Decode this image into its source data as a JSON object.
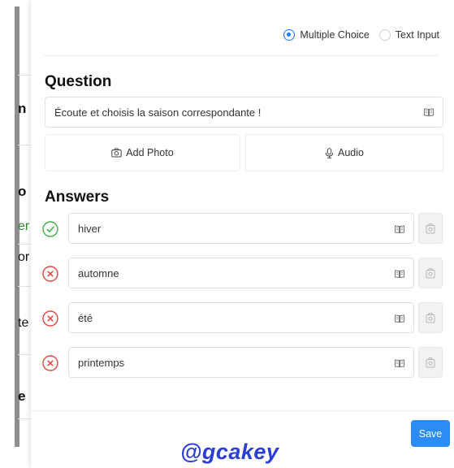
{
  "background_fragments": [
    "n",
    "o",
    "er",
    "or",
    "te",
    "e"
  ],
  "question_type": {
    "options": [
      {
        "label": "Multiple Choice",
        "selected": true
      },
      {
        "label": "Text Input",
        "selected": false
      }
    ]
  },
  "question": {
    "heading": "Question",
    "value": "Écoute et choisis la saison correspondante !",
    "translate_icon": "book-icon"
  },
  "media": {
    "add_photo_label": "Add Photo",
    "audio_label": "Audio"
  },
  "answers": {
    "heading": "Answers",
    "items": [
      {
        "text": "hiver",
        "correct": true
      },
      {
        "text": "automne",
        "correct": false
      },
      {
        "text": "été",
        "correct": false
      },
      {
        "text": "printemps",
        "correct": false
      }
    ]
  },
  "footer": {
    "save_label": "Save"
  },
  "watermark": "@gcakey",
  "colors": {
    "accent": "#2c8cf4",
    "correct": "#3fae4a",
    "wrong": "#e4473c"
  }
}
